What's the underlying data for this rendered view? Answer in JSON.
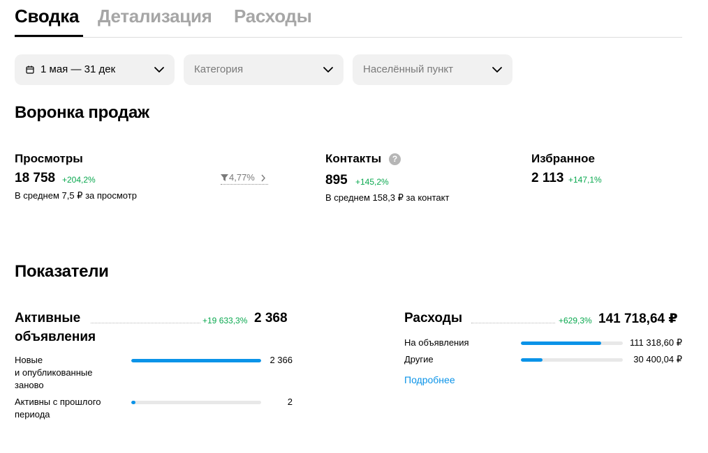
{
  "tabs": [
    {
      "label": "Сводка",
      "active": true
    },
    {
      "label": "Детализация",
      "active": false
    },
    {
      "label": "Расходы",
      "active": false
    }
  ],
  "filters": {
    "period": {
      "value": "1 мая — 31 дек",
      "icon": "calendar-icon"
    },
    "category": {
      "placeholder": "Категория"
    },
    "location": {
      "placeholder": "Населённый пункт"
    }
  },
  "funnel": {
    "title": "Воронка продаж",
    "views": {
      "title": "Просмотры",
      "value": "18 758",
      "delta": "+204,2%",
      "sub": "В среднем 7,5 ₽ за просмотр"
    },
    "conversion": {
      "value": "4,77%"
    },
    "contacts": {
      "title": "Контакты",
      "help": "?",
      "value": "895",
      "delta": "+145,2%",
      "sub": "В среднем 158,3 ₽ за контакт"
    },
    "favorites": {
      "title": "Избранное",
      "value": "2 113",
      "delta": "+147,1%"
    }
  },
  "indicators": {
    "title": "Показатели",
    "active_ads": {
      "title_line1": "Активные",
      "title_line2": "объявления",
      "delta": "+19 633,3%",
      "value": "2 368",
      "rows": [
        {
          "label_lines": [
            "Новые",
            "и опубликованные",
            "заново"
          ],
          "value": "2 366",
          "fraction": 0.999
        },
        {
          "label_lines": [
            "Активны с прошлого",
            "периода"
          ],
          "value": "2",
          "fraction": 0.03
        }
      ]
    },
    "expenses": {
      "title": "Расходы",
      "delta": "+629,3%",
      "value": "141 718,64 ₽",
      "rows": [
        {
          "label": "На объявления",
          "value": "111 318,60 ₽",
          "fraction": 0.785
        },
        {
          "label": "Другие",
          "value": "30 400,04 ₽",
          "fraction": 0.215
        }
      ],
      "link": "Подробнее"
    }
  },
  "colors": {
    "accent": "#0a93e8",
    "positive": "#0aa84f",
    "muted": "#a6a6a6",
    "filter_bg": "#f1f1f1"
  }
}
